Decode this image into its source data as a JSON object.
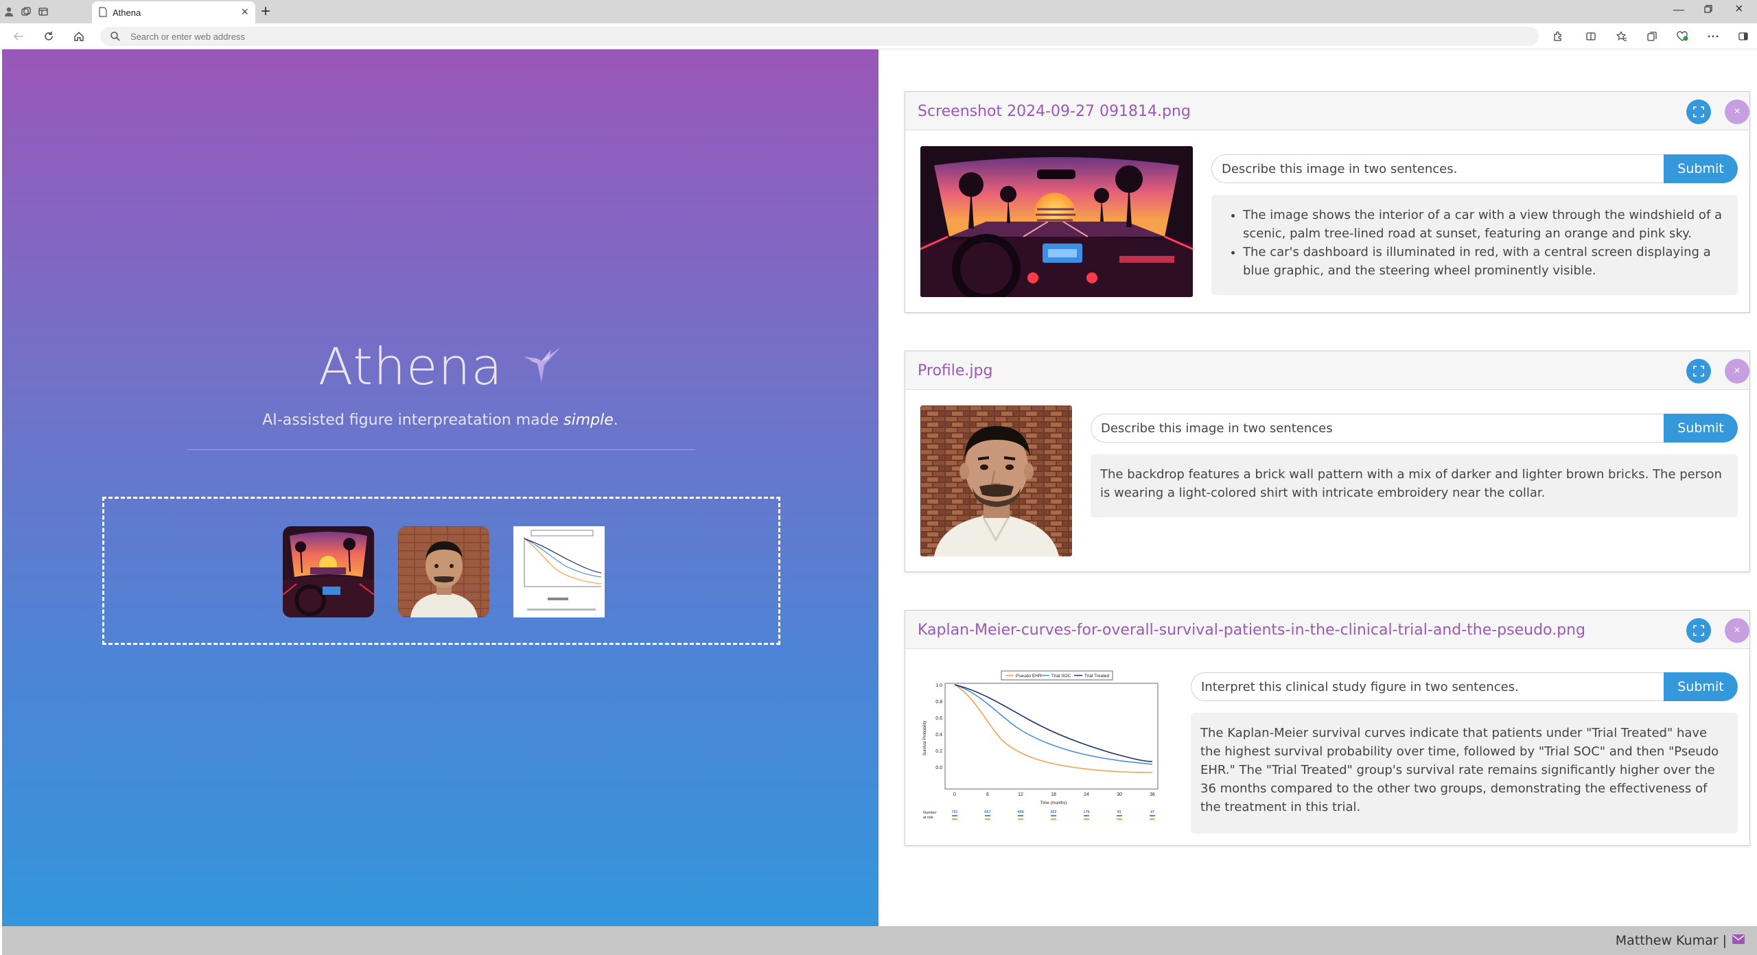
{
  "browser": {
    "tab_title": "Athena",
    "address_placeholder": "Search or enter web address"
  },
  "hero": {
    "title": "Athena",
    "tagline_prefix": "AI-assisted figure interpreatation made ",
    "tagline_emphasis": "simple",
    "tagline_suffix": "."
  },
  "cards": [
    {
      "title": "Screenshot 2024-09-27 091814.png",
      "prompt": "Describe this image in two sentences.",
      "submit_label": "Submit",
      "answer_bullets": [
        "The image shows the interior of a car with a view through the windshield of a scenic, palm tree-lined road at sunset, featuring an orange and pink sky.",
        "The car's dashboard is illuminated in red, with a central screen displaying a blue graphic, and the steering wheel prominently visible."
      ]
    },
    {
      "title": "Profile.jpg",
      "prompt": "Describe this image in two sentences",
      "submit_label": "Submit",
      "answer": "The backdrop features a brick wall pattern with a mix of darker and lighter brown bricks. The person is wearing a light-colored shirt with intricate embroidery near the collar."
    },
    {
      "title": "Kaplan-Meier-curves-for-overall-survival-patients-in-the-clinical-trial-and-the-pseudo.png",
      "prompt": "Interpret this clinical study figure in two sentences.",
      "submit_label": "Submit",
      "answer": "The Kaplan-Meier survival curves indicate that patients under \"Trial Treated\" have the highest survival probability over time, followed by \"Trial SOC\" and then \"Pseudo EHR.\" The \"Trial Treated\" group's survival rate remains significantly higher over the 36 months compared to the other two groups, demonstrating the effectiveness of the treatment in this trial."
    }
  ],
  "km_figure": {
    "legend": [
      "Pseudo EHR",
      "Trial SOC",
      "Trial Treated"
    ],
    "y_ticks": [
      "1.0",
      "0.8",
      "0.6",
      "0.4",
      "0.2",
      "0.0"
    ],
    "x_ticks": [
      "0",
      "6",
      "12",
      "18",
      "24",
      "30",
      "36"
    ],
    "xlabel": "Time (months)",
    "ylabel": "Survival Probability",
    "risk_label_1": "Number",
    "risk_label_2": "at risk",
    "risk_row": [
      "791",
      "667",
      "489",
      "362",
      "176",
      "81",
      "47"
    ]
  },
  "footer": {
    "user": "Matthew Kumar |"
  },
  "colors": {
    "accent_purple": "#9b59b6",
    "accent_blue": "#3498db",
    "km_orange": "#f5a04a",
    "km_blue": "#4a90d9",
    "km_navy": "#1f2f6f"
  },
  "icons": [
    "profile-icon",
    "workspaces-icon",
    "tab-actions-icon",
    "page-icon",
    "back-icon",
    "refresh-icon",
    "home-icon",
    "search-icon",
    "extensions-icon",
    "split-screen-icon",
    "favorites-icon",
    "collections-icon",
    "browser-essentials-icon",
    "more-icon",
    "sidebar-icon",
    "hummingbird-icon",
    "expand-icon",
    "close-icon",
    "envelope-icon"
  ]
}
